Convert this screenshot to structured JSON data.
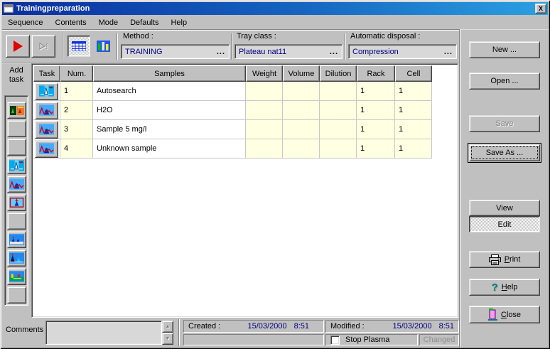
{
  "window": {
    "title": "Trainingpreparation",
    "close_glyph": "X"
  },
  "menu": {
    "items": [
      "Sequence",
      "Contents",
      "Mode",
      "Defaults",
      "Help"
    ]
  },
  "toolbar": {
    "method_label": "Method :",
    "method_value": "TRAINING",
    "tray_label": "Tray class :",
    "tray_value": "Plateau nat11",
    "disposal_label": "Automatic disposal :",
    "disposal_value": "Compression",
    "ellipsis": "..."
  },
  "sidebar": {
    "add_line1": "Add",
    "add_line2": "task"
  },
  "table": {
    "headers": [
      "Task",
      "Num.",
      "Samples",
      "Weight",
      "Volume",
      "Dilution",
      "Rack",
      "Cell"
    ],
    "rows": [
      {
        "num": "1",
        "samples": "Autosearch",
        "weight": "",
        "volume": "",
        "dilution": "",
        "rack": "1",
        "cell": "1"
      },
      {
        "num": "2",
        "samples": "H2O",
        "weight": "",
        "volume": "",
        "dilution": "",
        "rack": "1",
        "cell": "1"
      },
      {
        "num": "3",
        "samples": "Sample 5 mg/l",
        "weight": "",
        "volume": "",
        "dilution": "",
        "rack": "1",
        "cell": "1"
      },
      {
        "num": "4",
        "samples": "Unknown sample",
        "weight": "",
        "volume": "",
        "dilution": "",
        "rack": "1",
        "cell": "1"
      }
    ]
  },
  "actions": {
    "new_label": "New ...",
    "open_label": "Open ...",
    "save_label": "Save",
    "save_as_label": "Save As ...",
    "view_label": "View",
    "edit_label": "Edit",
    "print": {
      "u": "P",
      "rest": "rint"
    },
    "help": {
      "u": "H",
      "rest": "elp"
    },
    "close": {
      "u": "C",
      "rest": "lose"
    }
  },
  "footer": {
    "comments_label": "Comments :",
    "created_label": "Created :",
    "created_date": "15/03/2000",
    "created_time": "8:51",
    "modified_label": "Modified :",
    "modified_date": "15/03/2000",
    "modified_time": "8:51",
    "stop_plasma_label": "Stop Plasma",
    "changed_label": "Changed"
  },
  "icons": {
    "spin_up": "▲",
    "spin_down": "▼",
    "help_qmark": "?"
  },
  "colors": {
    "titlebar_start": "#0a2da0",
    "titlebar_end": "#2ba0e2",
    "value_navy": "#000080",
    "cell_yellow": "#ffffe1",
    "face": "#c0c0c0"
  }
}
